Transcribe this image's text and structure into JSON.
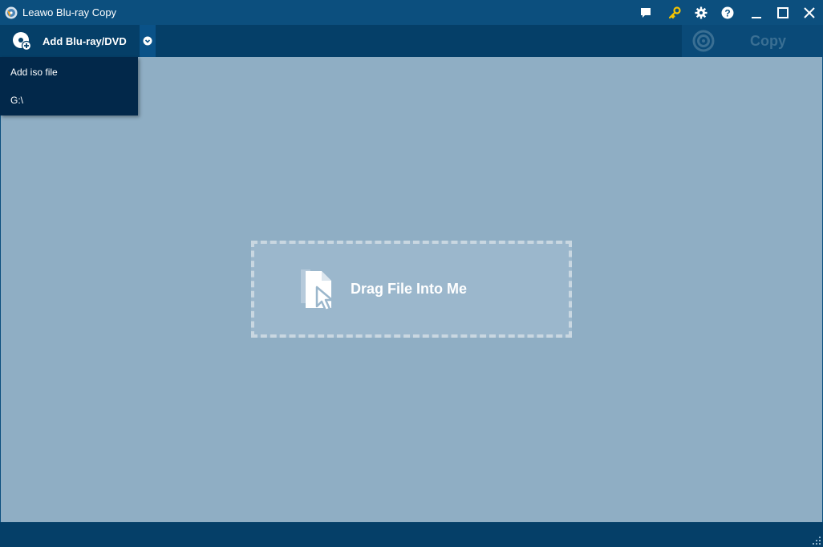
{
  "window": {
    "title": "Leawo Blu-ray Copy",
    "icons": [
      "feedback-icon",
      "key-icon",
      "gear-icon",
      "help-icon",
      "minimize-icon",
      "maximize-icon",
      "close-icon"
    ]
  },
  "toolbar": {
    "add_label": "Add Blu-ray/DVD",
    "copy_label": "Copy"
  },
  "menu": {
    "items": [
      {
        "label": "Add iso file"
      },
      {
        "label": "G:\\"
      }
    ]
  },
  "drop_zone": {
    "text": "Drag File Into Me"
  },
  "colors": {
    "titlebar": "#0c4f7e",
    "toolbar": "#053f68",
    "menu": "#02284a",
    "workspace": "#8faec4",
    "key_accent": "#f5c400"
  }
}
